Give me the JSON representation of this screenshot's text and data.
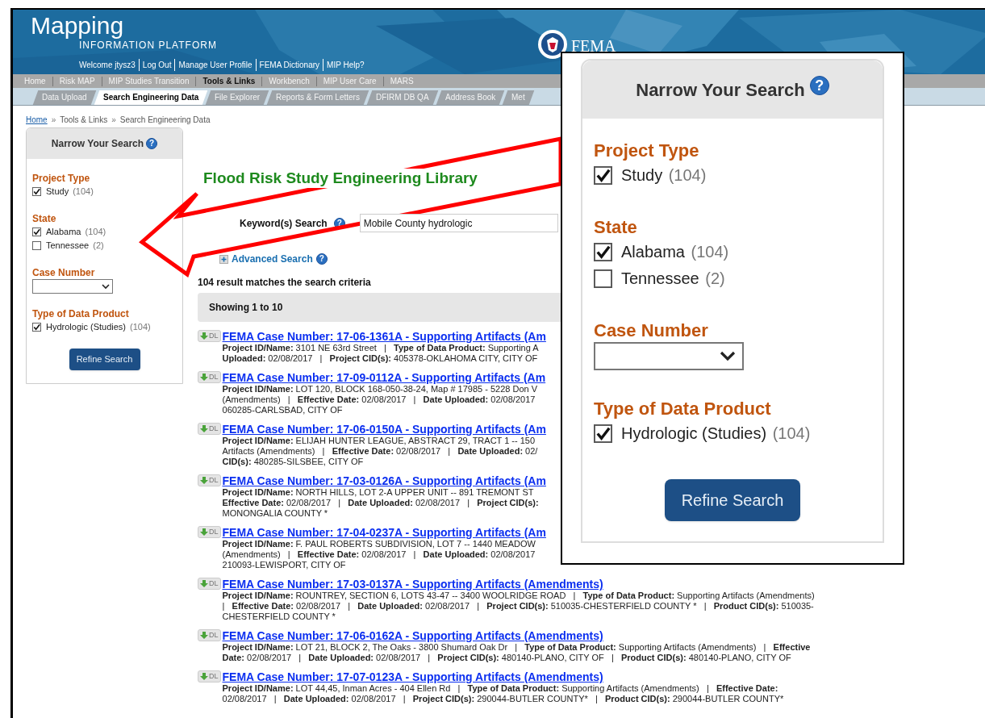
{
  "header": {
    "title": "Mapping",
    "subtitle": "INFORMATION PLATFORM",
    "agency": "FEMA",
    "user_links": [
      "Welcome jtysz3",
      "Log Out",
      "Manage User Profile",
      "FEMA Dictionary",
      "MIP Help?"
    ]
  },
  "nav": [
    {
      "label": "Home",
      "selected": false
    },
    {
      "label": "Risk MAP",
      "selected": false
    },
    {
      "label": "MIP Studies Transition",
      "selected": false
    },
    {
      "label": "Tools & Links",
      "selected": true
    },
    {
      "label": "Workbench",
      "selected": false
    },
    {
      "label": "MIP User Care",
      "selected": false
    },
    {
      "label": "MARS",
      "selected": false
    }
  ],
  "subnav": [
    {
      "label": "Data Upload",
      "selected": false
    },
    {
      "label": "Search Engineering Data",
      "selected": true
    },
    {
      "label": "File Explorer",
      "selected": false
    },
    {
      "label": "Reports & Form Letters",
      "selected": false
    },
    {
      "label": "DFIRM DB QA",
      "selected": false
    },
    {
      "label": "Address Book",
      "selected": false
    },
    {
      "label": "Met",
      "selected": false
    }
  ],
  "breadcrumb": [
    {
      "kind": "link",
      "label": "Home"
    },
    {
      "kind": "separator",
      "label": "»"
    },
    {
      "kind": "text",
      "label": "Tools & Links"
    },
    {
      "kind": "separator",
      "label": "»"
    },
    {
      "kind": "text",
      "label": "Search Engineering Data"
    }
  ],
  "filter_panel": {
    "title": "Narrow Your Search",
    "help": "?",
    "sections": [
      {
        "kind": "checkboxes",
        "title": "Project Type",
        "options": [
          {
            "label": "Study",
            "count": "(104)",
            "checked": true
          }
        ]
      },
      {
        "kind": "checkboxes",
        "title": "State",
        "options": [
          {
            "label": "Alabama",
            "count": "(104)",
            "checked": true
          },
          {
            "label": "Tennessee",
            "count": "(2)",
            "checked": false
          }
        ]
      },
      {
        "kind": "select",
        "title": "Case Number"
      },
      {
        "kind": "checkboxes",
        "title": "Type of Data Product",
        "options": [
          {
            "label": "Hydrologic (Studies)",
            "count": "(104)",
            "checked": true
          }
        ]
      }
    ],
    "button": "Refine Search"
  },
  "main": {
    "title": "Flood Risk Study Engineering Library",
    "keyword_label": "Keyword(s) Search",
    "keyword_help": "?",
    "keyword_value": "Mobile County hydrologic",
    "advanced_search": "Advanced Search",
    "advanced_help": "?",
    "result_count": "104 result matches the search criteria",
    "showing": "Showing 1 to 10",
    "results": [
      {
        "button": "DL",
        "title": "FEMA Case Number: 17-06-1361A - Supporting Artifacts (Am",
        "lines": [
          "**Project ID/Name:** 3101 NE 63rd Street   |   **Type of Data Product:** Supporting A",
          "**Uploaded:** 02/08/2017   |   **Project CID(s):** 405378-OKLAHOMA CITY, CITY OF"
        ]
      },
      {
        "button": "DL",
        "title": "FEMA Case Number: 17-09-0112A - Supporting Artifacts (Am",
        "lines": [
          "**Project ID/Name:** LOT 120, BLOCK 168-050-38-24, Map # 17985 - 5228 Don V",
          "(Amendments)   |   **Effective Date:** 02/08/2017   |   **Date Uploaded:** 02/08/2017",
          "060285-CARLSBAD, CITY OF"
        ]
      },
      {
        "button": "DL",
        "title": "FEMA Case Number: 17-06-0150A - Supporting Artifacts (Am",
        "lines": [
          "**Project ID/Name:** ELIJAH HUNTER LEAGUE, ABSTRACT 29, TRACT 1 -- 150",
          "Artifacts (Amendments)   |   **Effective Date:** 02/08/2017   |   **Date Uploaded:** 02/",
          "**CID(s):** 480285-SILSBEE, CITY OF"
        ]
      },
      {
        "button": "DL",
        "title": "FEMA Case Number: 17-03-0126A - Supporting Artifacts (Am",
        "lines": [
          "**Project ID/Name:** NORTH HILLS, LOT 2-A UPPER UNIT -- 891 TREMONT ST",
          "**Effective Date:** 02/08/2017   |   **Date Uploaded:** 02/08/2017   |   **Project CID(s):**",
          "MONONGALIA COUNTY *"
        ]
      },
      {
        "button": "DL",
        "title": "FEMA Case Number: 17-04-0237A - Supporting Artifacts (Am",
        "lines": [
          "**Project ID/Name:** F. PAUL ROBERTS SUBDIVISION, LOT 7 -- 1440 MEADOW",
          "(Amendments)   |   **Effective Date:** 02/08/2017   |   **Date Uploaded:** 02/08/2017",
          "210093-LEWISPORT, CITY OF"
        ]
      },
      {
        "button": "DL",
        "title": "FEMA Case Number: 17-03-0137A - Supporting Artifacts (Amendments)",
        "lines": [
          "**Project ID/Name:** ROUNTREY, SECTION 6, LOTS 43-47 -- 3400 WOOLRIDGE ROAD   |   **Type of Data Product:** Supporting Artifacts (Amendments)",
          "|   **Effective Date:** 02/08/2017   |   **Date Uploaded:** 02/08/2017   |   **Project CID(s):** 510035-CHESTERFIELD COUNTY *   |   **Product CID(s):** 510035-",
          "CHESTERFIELD COUNTY *"
        ]
      },
      {
        "button": "DL",
        "title": "FEMA Case Number: 17-06-0162A - Supporting Artifacts (Amendments)",
        "lines": [
          "**Project ID/Name:** LOT 21, BLOCK 2, The Oaks - 3800 Shumard Oak Dr   |   **Type of Data Product:** Supporting Artifacts (Amendments)   |   **Effective**",
          "**Date:** 02/08/2017   |   **Date Uploaded:** 02/08/2017   |   **Project CID(s):** 480140-PLANO, CITY OF   |   **Product CID(s):** 480140-PLANO, CITY OF"
        ]
      },
      {
        "button": "DL",
        "title": "FEMA Case Number: 17-07-0123A - Supporting Artifacts (Amendments)",
        "lines": [
          "**Project ID/Name:** LOT 44,45, Inman Acres - 404 Ellen Rd   |   **Type of Data Product:** Supporting Artifacts (Amendments)   |   **Effective Date:**",
          "02/08/2017   |   **Date Uploaded:** 02/08/2017   |   **Project CID(s):** 290044-BUTLER COUNTY*   |   **Product CID(s):** 290044-BUTLER COUNTY*"
        ]
      }
    ]
  },
  "zoomed_filter_panel": {
    "title": "Narrow Your Search",
    "help": "?",
    "sections": [
      {
        "kind": "checkboxes",
        "title": "Project Type",
        "options": [
          {
            "label": "Study",
            "count": "(104)",
            "checked": true
          }
        ]
      },
      {
        "kind": "checkboxes",
        "title": "State",
        "options": [
          {
            "label": "Alabama",
            "count": "(104)",
            "checked": true
          },
          {
            "label": "Tennessee",
            "count": "(2)",
            "checked": false
          }
        ]
      },
      {
        "kind": "select",
        "title": "Case Number"
      },
      {
        "kind": "checkboxes",
        "title": "Type of Data Product",
        "options": [
          {
            "label": "Hydrologic (Studies)",
            "count": "(104)",
            "checked": true
          }
        ]
      }
    ],
    "button": "Refine Search"
  }
}
